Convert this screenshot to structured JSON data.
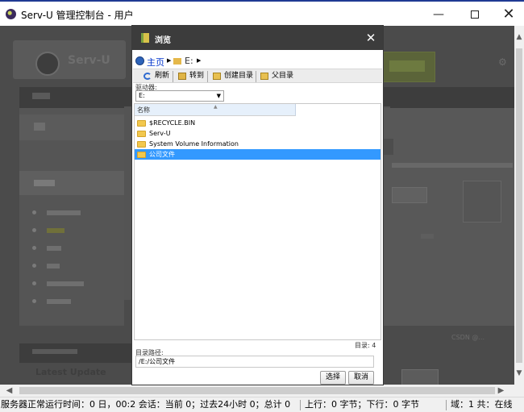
{
  "window": {
    "title": "Serv-U 管理控制台 - 用户",
    "minimize_glyph": "—",
    "close_glyph": "✕"
  },
  "background": {
    "logo_text": "Serv-U",
    "latest_update": "Latest Update",
    "credit": "CSDN @..."
  },
  "dialog": {
    "title": "浏览",
    "close_glyph": "✕",
    "breadcrumb": {
      "home": "主页",
      "drive": "E:"
    },
    "toolbar": {
      "refresh": "刷新",
      "goto": "转到",
      "create_dir": "创建目录",
      "parent_dir": "父目录"
    },
    "drive_label": "驱动器:",
    "drive_value": "E:",
    "list_header": "名称",
    "items": [
      {
        "name": "$RECYCLE.BIN",
        "selected": false,
        "icon": "folder-icon"
      },
      {
        "name": "Serv-U",
        "selected": false,
        "icon": "folder-icon"
      },
      {
        "name": "System Volume Information",
        "selected": false,
        "icon": "folder-icon"
      },
      {
        "name": "公司文件",
        "selected": true,
        "icon": "folder-icon"
      }
    ],
    "count_text": "目录: 4",
    "path_label": "目录路径:",
    "path_value": "/E:/公司文件",
    "select_button": "选择",
    "cancel_button": "取消"
  },
  "statusbar": {
    "left": "服务器正常运行时间：0 日，00:2 会话：当前 0；过去24小时 0；总计 0",
    "middle": "上行：0 字节；下行：0 字节",
    "right": "域：1 共：在线"
  },
  "colors": {
    "dialog_title_bg": "#3c3c3c",
    "selection": "#3399ff",
    "link": "#0033cc",
    "overlay": "#4b4b4b"
  }
}
